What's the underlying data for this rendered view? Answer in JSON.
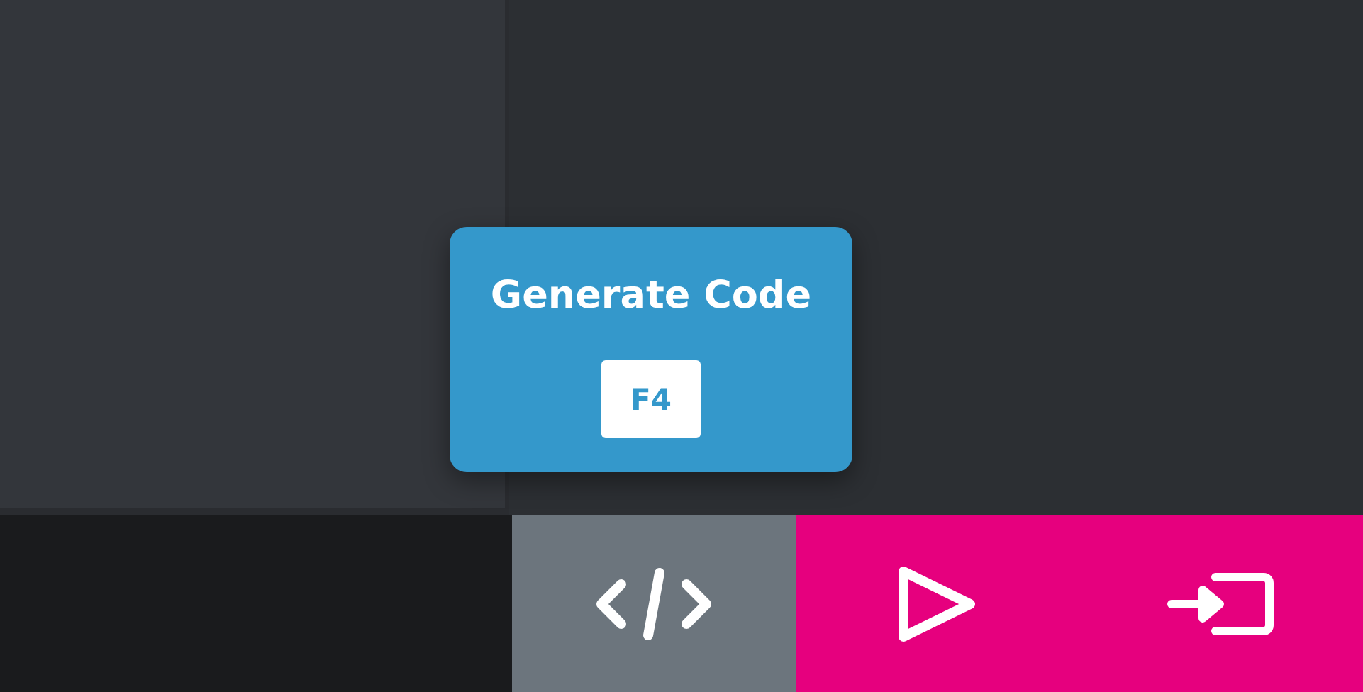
{
  "tooltip": {
    "title": "Generate Code",
    "shortcut": "F4"
  },
  "toolbar": {
    "buttons": [
      {
        "kind": "code"
      },
      {
        "kind": "play"
      },
      {
        "kind": "enter"
      }
    ]
  }
}
